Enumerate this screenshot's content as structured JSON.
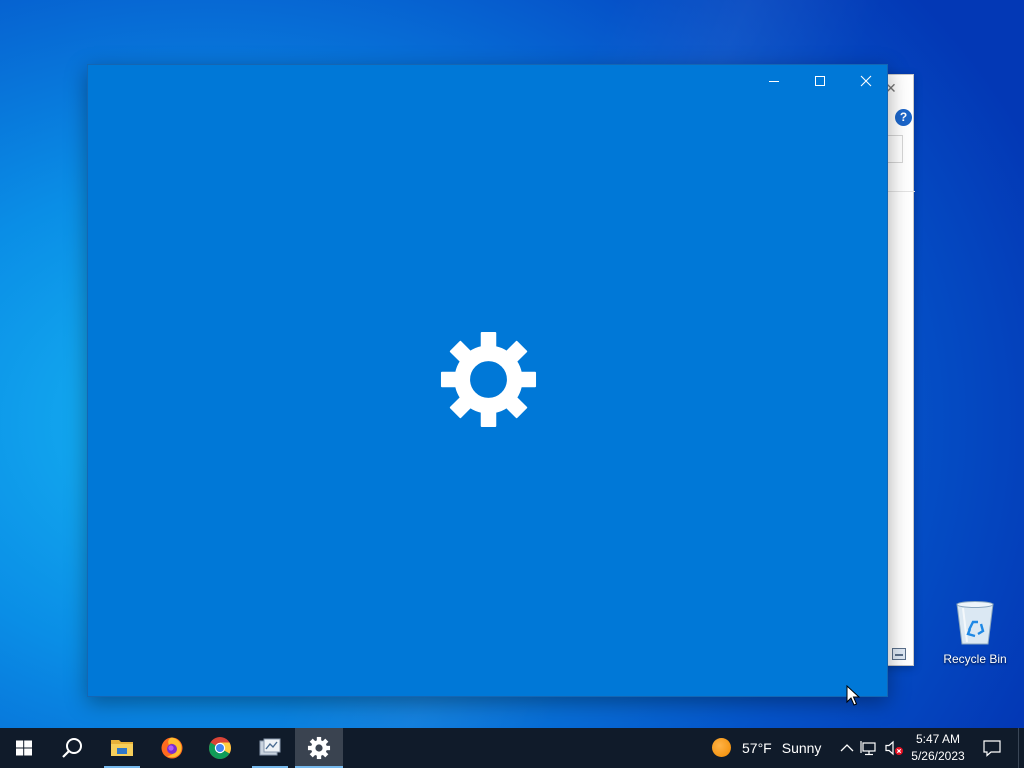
{
  "desktop": {
    "icons": [
      {
        "label": "Recycle Bin",
        "icon": "recycle-bin-icon"
      }
    ]
  },
  "splash_window": {
    "icon": "gear-icon",
    "background_color": "#0078d7",
    "controls": {
      "minimize": "minimize-icon",
      "maximize": "maximize-icon",
      "close": "close-icon"
    }
  },
  "background_dialog": {
    "help_label": "?"
  },
  "taskbar": {
    "start": "windows-start-icon",
    "search": "search-icon",
    "pinned": [
      {
        "app": "file-explorer-icon",
        "running": true
      },
      {
        "app": "firefox-icon",
        "running": false
      },
      {
        "app": "chrome-icon",
        "running": false
      },
      {
        "app": "app-window-icon",
        "running": true
      },
      {
        "app": "settings-gear-icon",
        "running": true,
        "active": true
      }
    ],
    "weather": {
      "temperature": "57°F",
      "condition": "Sunny",
      "icon": "sun-icon"
    },
    "tray": [
      "chevron-up-icon",
      "network-icon",
      "volume-muted-icon"
    ],
    "clock": {
      "time": "5:47 AM",
      "date": "5/26/2023"
    },
    "notifications": "action-center-icon"
  }
}
